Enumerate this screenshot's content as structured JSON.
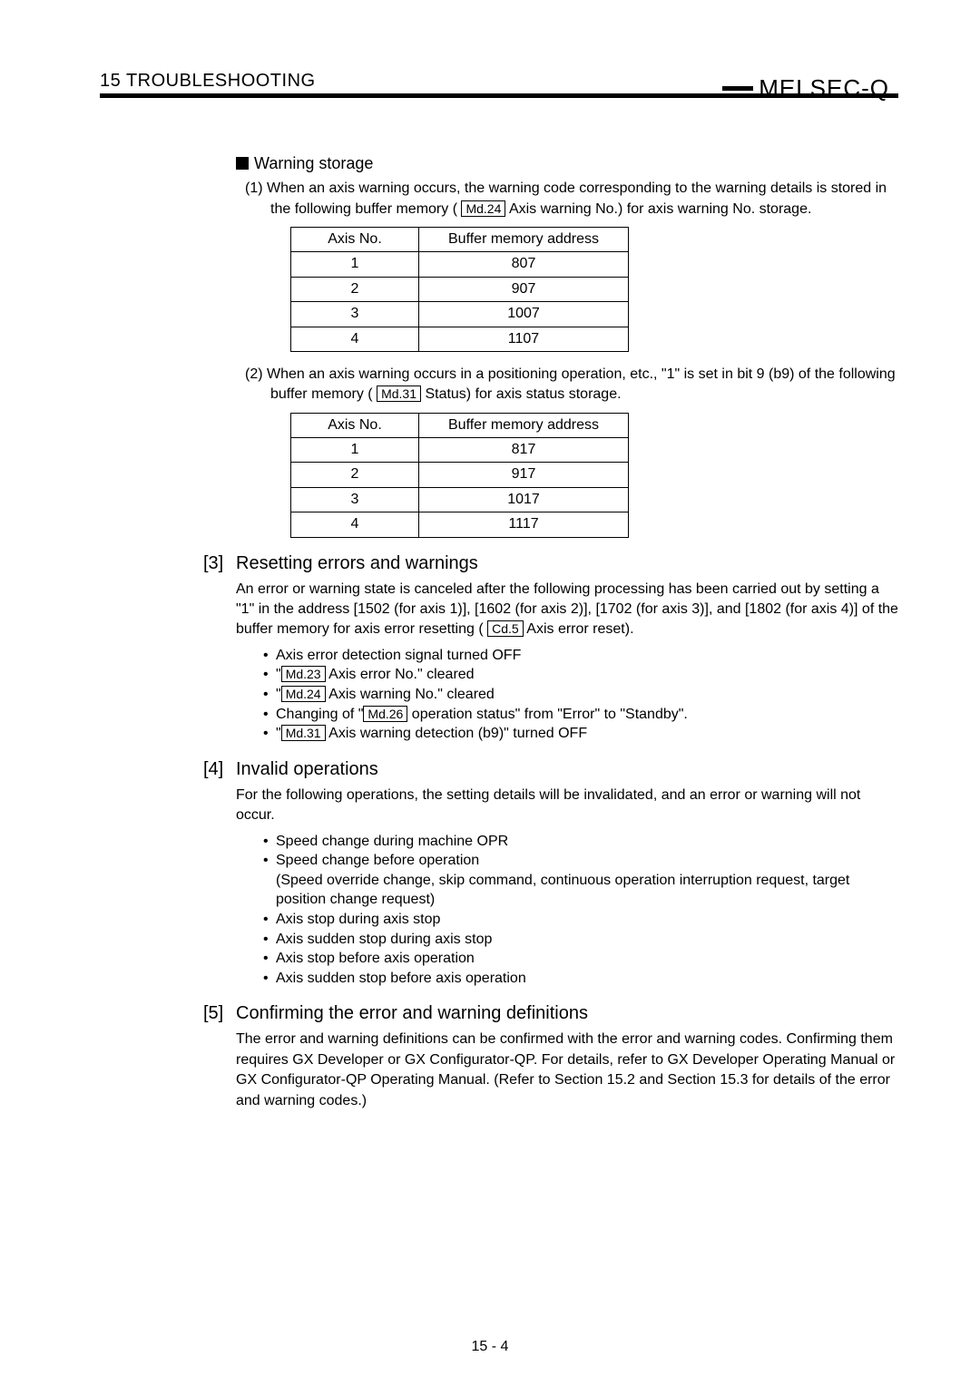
{
  "header": {
    "chapter": "15   TROUBLESHOOTING",
    "brand": "MELSEC-Q"
  },
  "warning_storage": {
    "title": "Warning storage",
    "item1": {
      "num": "(1)",
      "pre": "When an axis warning occurs, the warning code corresponding to the warning details is stored in the following buffer memory (",
      "code": "Md.24",
      "post": " Axis warning No.) for axis warning No. storage."
    },
    "item2": {
      "num": "(2)",
      "pre": "When an axis warning occurs in a positioning operation, etc., \"1\" is set in bit 9 (b9) of the following buffer memory (",
      "code": "Md.31",
      "post": " Status) for axis status storage."
    }
  },
  "table_header": {
    "col1": "Axis No.",
    "col2": "Buffer memory address"
  },
  "table1": [
    {
      "axis": "1",
      "addr": "807"
    },
    {
      "axis": "2",
      "addr": "907"
    },
    {
      "axis": "3",
      "addr": "1007"
    },
    {
      "axis": "4",
      "addr": "1107"
    }
  ],
  "table2": [
    {
      "axis": "1",
      "addr": "817"
    },
    {
      "axis": "2",
      "addr": "917"
    },
    {
      "axis": "3",
      "addr": "1017"
    },
    {
      "axis": "4",
      "addr": "1117"
    }
  ],
  "sec3": {
    "num": "[3]",
    "title": "Resetting errors and warnings",
    "body_pre": "An error or warning state is canceled after the following processing has been carried out by setting a \"1\" in the address [1502 (for axis 1)], [1602 (for axis 2)], [1702 (for axis 3)], and [1802 (for axis 4)] of the buffer memory for axis error resetting (",
    "body_code": "Cd.5",
    "body_post": " Axis error reset).",
    "b1": "Axis error detection signal turned OFF",
    "b2_code": "Md.23",
    "b2_post": " Axis error No.\" cleared",
    "b3_code": "Md.24",
    "b3_post": " Axis warning No.\" cleared",
    "b4_pre": "Changing of \"",
    "b4_code": "Md.26",
    "b4_post": " operation status\" from \"Error\" to \"Standby\".",
    "b5_code": "Md.31",
    "b5_post": " Axis warning detection (b9)\" turned OFF"
  },
  "sec4": {
    "num": "[4]",
    "title": "Invalid operations",
    "body": "For the following operations, the setting details will be invalidated, and an error or warning will not occur.",
    "bullets": [
      "Speed change during machine OPR",
      "Speed change before operation",
      "(Speed override change, skip command, continuous operation interruption request, target position change request)",
      "Axis stop during axis stop",
      "Axis sudden stop during axis stop",
      "Axis stop before axis operation",
      "Axis sudden stop before axis operation"
    ]
  },
  "sec5": {
    "num": "[5]",
    "title": "Confirming the error and warning definitions",
    "body": "The error and warning definitions can be confirmed with the error and warning codes. Confirming them requires GX Developer or GX Configurator-QP. For details, refer to GX Developer Operating Manual or GX Configurator-QP Operating Manual. (Refer to Section 15.2 and Section 15.3 for details of the error and warning codes.)"
  },
  "page_num": "15 - 4"
}
